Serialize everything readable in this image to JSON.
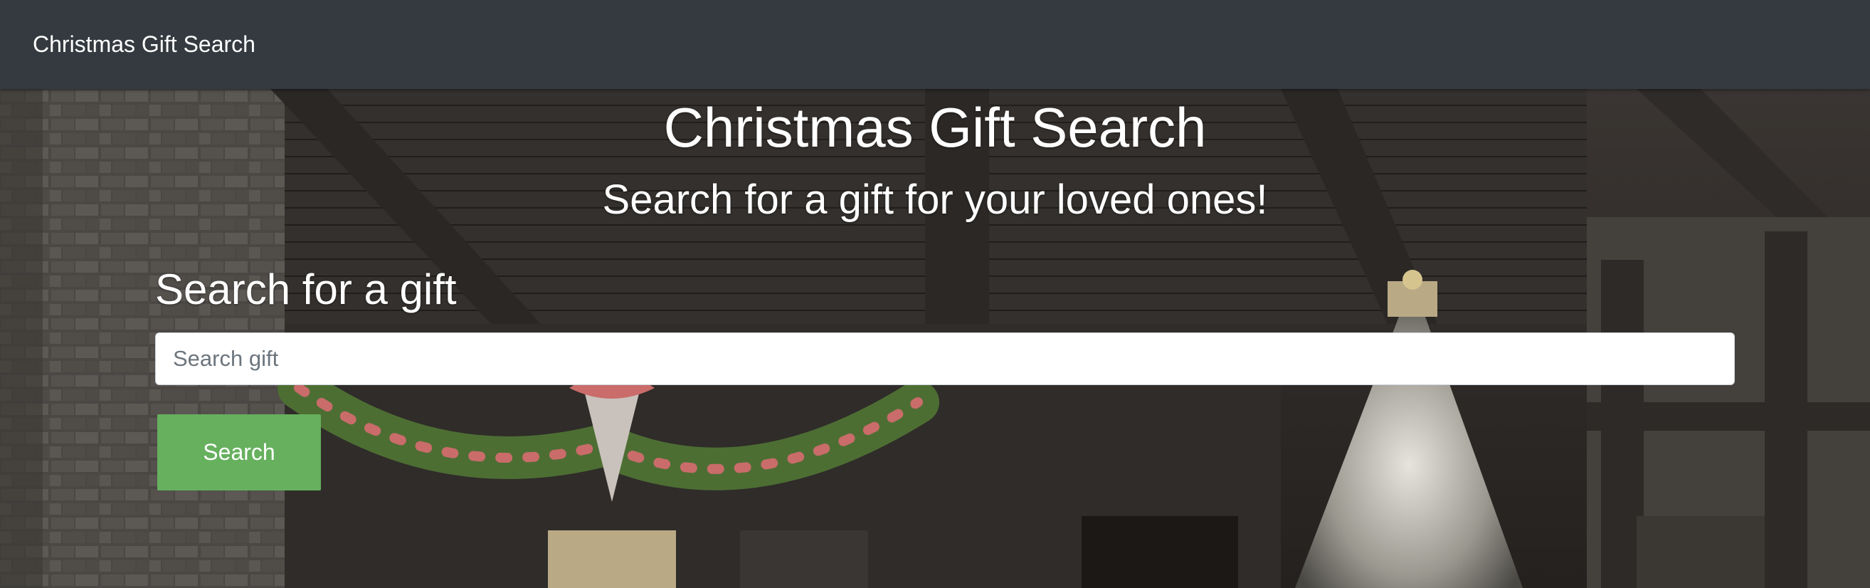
{
  "navbar": {
    "brand": "Christmas Gift Search"
  },
  "hero": {
    "title": "Christmas Gift Search",
    "subtitle": "Search for a gift for your loved ones!"
  },
  "search": {
    "label": "Search for a gift",
    "placeholder": "Search gift",
    "value": "",
    "button_label": "Search"
  },
  "colors": {
    "navbar_bg": "#343a40",
    "button_bg": "#66b05e",
    "text": "#ffffff"
  },
  "background": {
    "image": "christmas-interior-scene"
  }
}
